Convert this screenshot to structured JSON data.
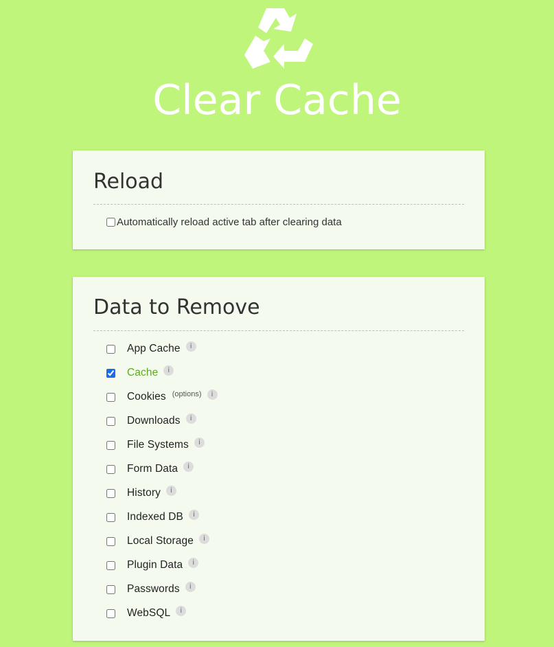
{
  "app": {
    "title": "Clear Cache",
    "logo_icon": "recycle-icon",
    "background_color": "#bff57a",
    "accent_color": "#5cab1e"
  },
  "reload": {
    "title": "Reload",
    "option_label": "Automatically reload active tab after clearing data",
    "option_checked": false
  },
  "data_to_remove": {
    "title": "Data to Remove",
    "info_glyph": "i",
    "items": [
      {
        "label": "App Cache",
        "checked": false
      },
      {
        "label": "Cache",
        "checked": true
      },
      {
        "label": "Cookies",
        "checked": false,
        "extra": "(options)"
      },
      {
        "label": "Downloads",
        "checked": false
      },
      {
        "label": "File Systems",
        "checked": false
      },
      {
        "label": "Form Data",
        "checked": false
      },
      {
        "label": "History",
        "checked": false
      },
      {
        "label": "Indexed DB",
        "checked": false
      },
      {
        "label": "Local Storage",
        "checked": false
      },
      {
        "label": "Plugin Data",
        "checked": false
      },
      {
        "label": "Passwords",
        "checked": false
      },
      {
        "label": "WebSQL",
        "checked": false
      }
    ]
  }
}
